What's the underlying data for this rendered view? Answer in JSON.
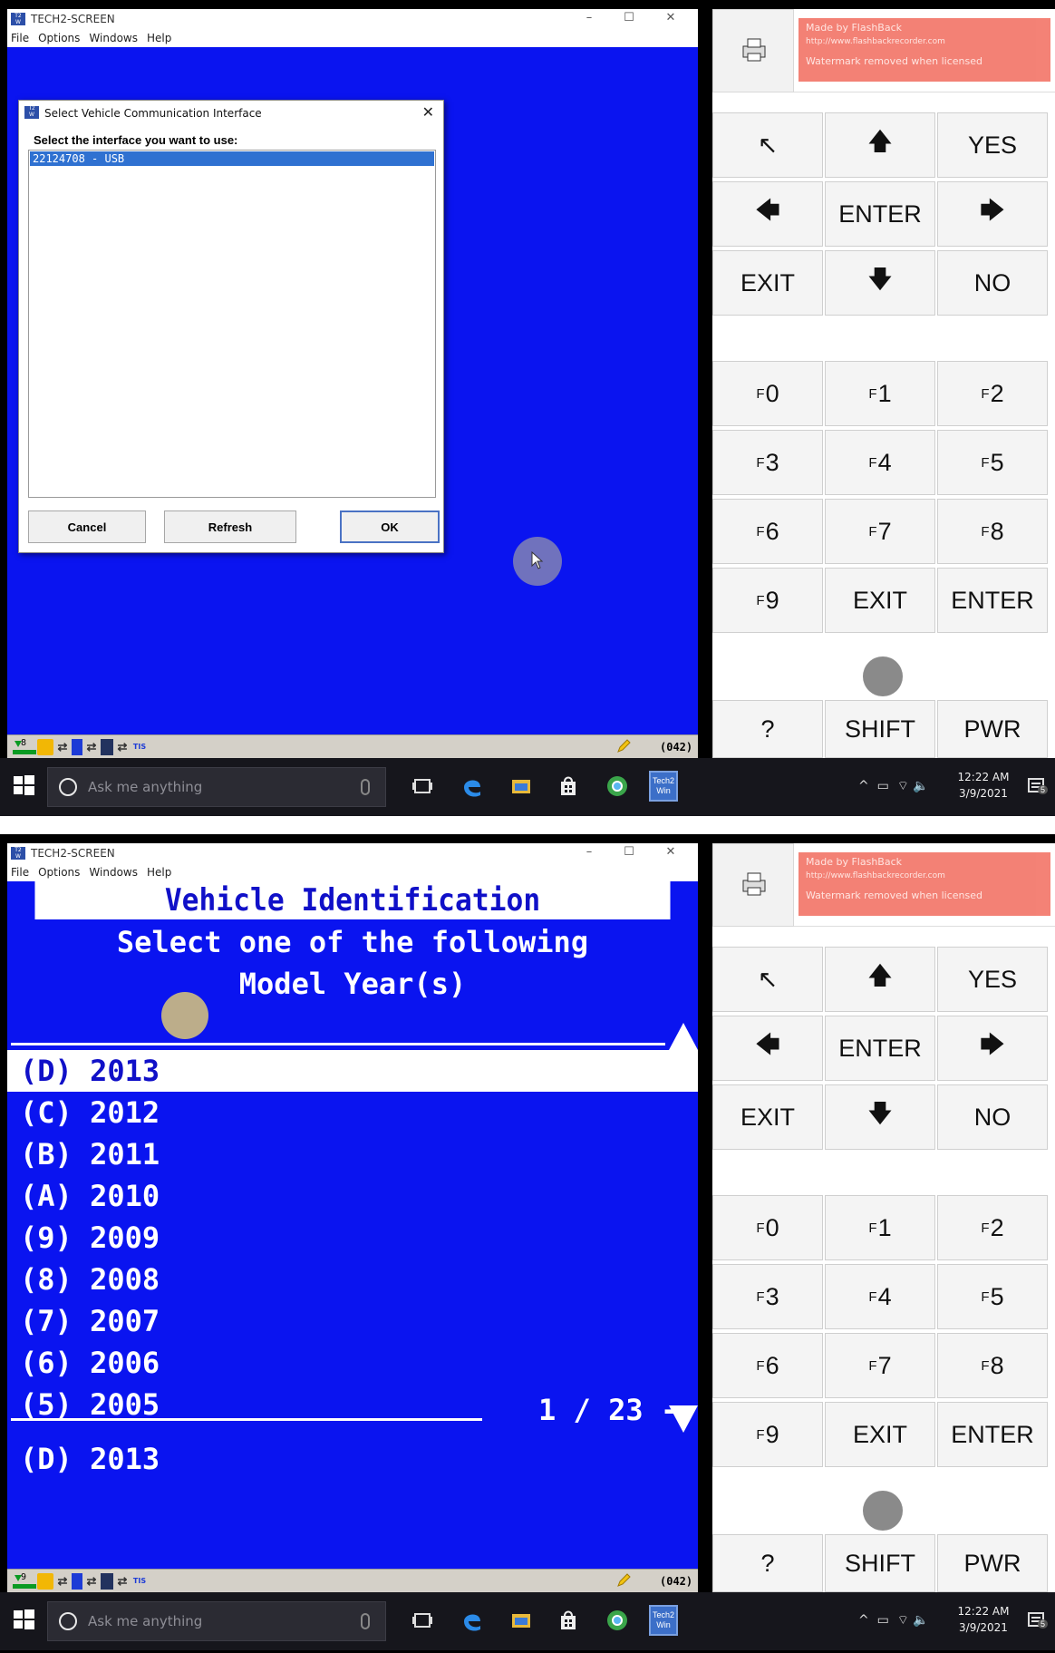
{
  "window": {
    "title": "TECH2-SCREEN",
    "app_icon_text": "Tech2 Win",
    "menu": [
      "File",
      "Options",
      "Windows",
      "Help"
    ],
    "minimize": "–",
    "maximize": "☐",
    "close": "✕"
  },
  "status_bar": {
    "battery_level_shot1": "8",
    "battery_level_shot2": "9",
    "tis_label": "TIS",
    "counter": "(042)"
  },
  "keypad": {
    "watermark": {
      "line1": "Made by FlashBack",
      "line2": "http://www.flashbackrecorder.com",
      "line3": "Watermark removed when licensed"
    },
    "nav_keys": [
      "↖",
      "🡅",
      "YES",
      "🡄",
      "ENTER",
      "🡆",
      "EXIT",
      "🡇",
      "NO"
    ],
    "f_prefix": "F",
    "f_numbers": [
      "0",
      "1",
      "2",
      "3",
      "4",
      "5",
      "6",
      "7",
      "8",
      "9"
    ],
    "exit_label": "EXIT",
    "enter_label": "ENTER",
    "help_label": "?",
    "shift_label": "SHIFT",
    "power_label": "PWR"
  },
  "taskbar": {
    "search_placeholder": "Ask me anything",
    "time": "12:22 AM",
    "date": "3/9/2021",
    "notification_count": "5",
    "tech2win_icon_text": "Tech2 Win"
  },
  "dialog": {
    "title": "Select Vehicle Communication Interface",
    "close": "✕",
    "prompt": "Select the interface you want to use:",
    "items": [
      "22124708 - USB"
    ],
    "buttons": {
      "cancel": "Cancel",
      "refresh": "Refresh",
      "ok": "OK"
    }
  },
  "vehicle_id": {
    "title": "Vehicle Identification",
    "subtitle1": "Select one of the following",
    "subtitle2": "Model Year(s)",
    "options": [
      "(D) 2013",
      "(C) 2012",
      "(B) 2011",
      "(A) 2010",
      "(9) 2009",
      "(8) 2008",
      "(7) 2007",
      "(6) 2006",
      "(5) 2005"
    ],
    "page_indicator": "1 / 23 -",
    "selected": "(D) 2013"
  },
  "colors": {
    "tech2_blue": "#0a14f0",
    "selection_blue": "#2f71d1",
    "watermark_red": "#f3776a",
    "taskbar": "#16161c"
  }
}
